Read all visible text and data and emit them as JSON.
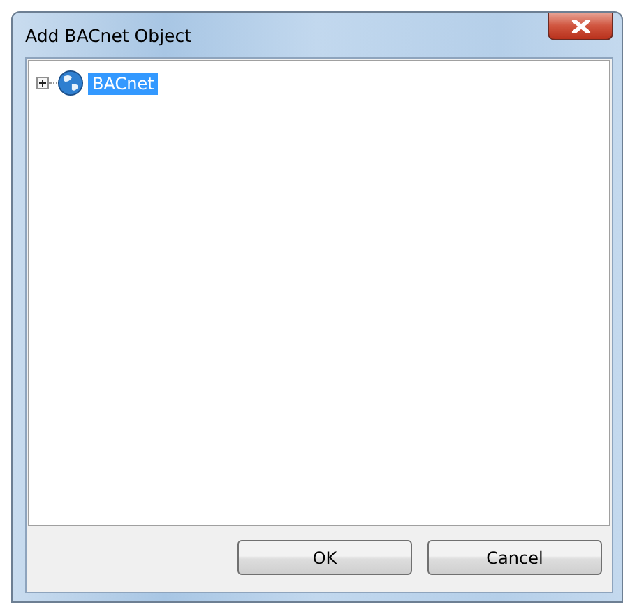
{
  "window": {
    "title": "Add BACnet Object"
  },
  "tree": {
    "items": [
      {
        "label": "BACnet",
        "expanded": false,
        "selected": true
      }
    ]
  },
  "buttons": [
    {
      "label": "OK"
    },
    {
      "label": "Cancel"
    }
  ]
}
